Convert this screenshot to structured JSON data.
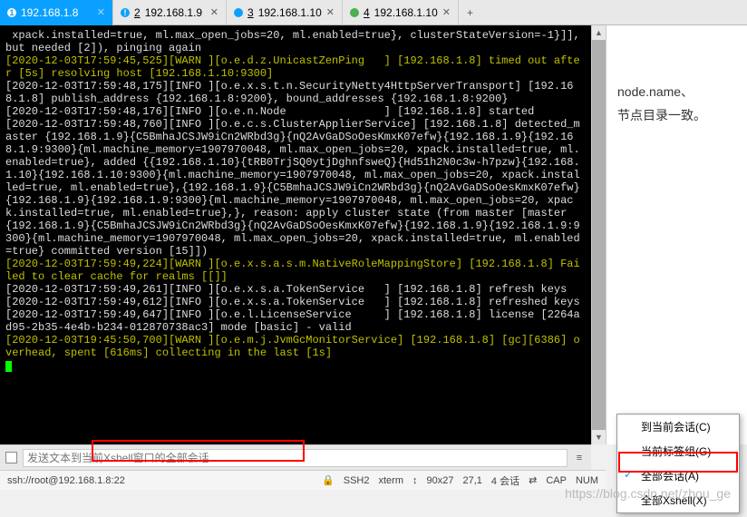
{
  "tabs": [
    {
      "num": "1",
      "host": "192.168.1.8",
      "dotClass": "active-dot"
    },
    {
      "num": "2",
      "host": "192.168.1.9",
      "dotClass": "blue-bang",
      "bang": "!"
    },
    {
      "num": "3",
      "host": "192.168.1.10",
      "dotClass": "blue"
    },
    {
      "num": "4",
      "host": "192.168.1.10",
      "dotClass": "green"
    }
  ],
  "newtab": "+",
  "terminal": {
    "lines": [
      {
        "t": " xpack.installed=true, ml.max_open_jobs=20, ml.enabled=true}, clusterStateVersion=-1}]], but needed [2]), pinging again",
        "c": ""
      },
      {
        "t": "[2020-12-03T17:59:45,525][WARN ][o.e.d.z.UnicastZenPing   ] [192.168.1.8] timed out after [5s] resolving host [192.168.1.10:9300]",
        "c": "warn"
      },
      {
        "t": "[2020-12-03T17:59:48,175][INFO ][o.e.x.s.t.n.SecurityNetty4HttpServerTransport] [192.168.1.8] publish_address {192.168.1.8:9200}, bound_addresses {192.168.1.8:9200}",
        "c": ""
      },
      {
        "t": "[2020-12-03T17:59:48,176][INFO ][o.e.n.Node               ] [192.168.1.8] started",
        "c": ""
      },
      {
        "t": "[2020-12-03T17:59:48,760][INFO ][o.e.c.s.ClusterApplierService] [192.168.1.8] detected_master {192.168.1.9}{C5BmhaJCSJW9iCn2WRbd3g}{nQ2AvGaDSoOesKmxK07efw}{192.168.1.9}{192.168.1.9:9300}{ml.machine_memory=1907970048, ml.max_open_jobs=20, xpack.installed=true, ml.enabled=true}, added {{192.168.1.10}{tRB0TrjSQ0ytjDghnfsweQ}{Hd51h2N0c3w-h7pzw}{192.168.1.10}{192.168.1.10:9300}{ml.machine_memory=1907970048, ml.max_open_jobs=20, xpack.installed=true, ml.enabled=true},{192.168.1.9}{C5BmhaJCSJW9iCn2WRbd3g}{nQ2AvGaDSoOesKmxK07efw}{192.168.1.9}{192.168.1.9:9300}{ml.machine_memory=1907970048, ml.max_open_jobs=20, xpack.installed=true, ml.enabled=true},}, reason: apply cluster state (from master [master {192.168.1.9}{C5BmhaJCSJW9iCn2WRbd3g}{nQ2AvGaDSoOesKmxK07efw}{192.168.1.9}{192.168.1.9:9300}{ml.machine_memory=1907970048, ml.max_open_jobs=20, xpack.installed=true, ml.enabled=true} committed version [15]])",
        "c": ""
      },
      {
        "t": "[2020-12-03T17:59:49,224][WARN ][o.e.x.s.a.s.m.NativeRoleMappingStore] [192.168.1.8] Failed to clear cache for realms [[]]",
        "c": "warn"
      },
      {
        "t": "[2020-12-03T17:59:49,261][INFO ][o.e.x.s.a.TokenService   ] [192.168.1.8] refresh keys",
        "c": ""
      },
      {
        "t": "[2020-12-03T17:59:49,612][INFO ][o.e.x.s.a.TokenService   ] [192.168.1.8] refreshed keys",
        "c": ""
      },
      {
        "t": "[2020-12-03T17:59:49,647][INFO ][o.e.l.LicenseService     ] [192.168.1.8] license [2264ad95-2b35-4e4b-b234-012870738ac3] mode [basic] - valid",
        "c": ""
      },
      {
        "t": "[2020-12-03T19:45:50,700][WARN ][o.e.m.j.JvmGcMonitorService] [192.168.1.8] [gc][6386] overhead, spent [616ms] collecting in the last [1s]",
        "c": "warn"
      }
    ]
  },
  "side": {
    "line1": "node.name、",
    "line2": "节点目录一致。"
  },
  "input": {
    "placeholder": "发送文本到当前Xshell窗口的全部会话"
  },
  "status": {
    "conn": "ssh://root@192.168.1.8:22",
    "proto": "SSH2",
    "term": "xterm",
    "size": "90x27",
    "pos": "27,1",
    "sessions": "4 会话",
    "cap": "CAP",
    "num": "NUM"
  },
  "menu": {
    "i1": "到当前会话(C)",
    "i2": "当前标签组(G)",
    "i3": "全部会话(A)",
    "i4": "全部Xshell(X)"
  },
  "watermark": "https://blog.csdn.net/zhou_ge"
}
